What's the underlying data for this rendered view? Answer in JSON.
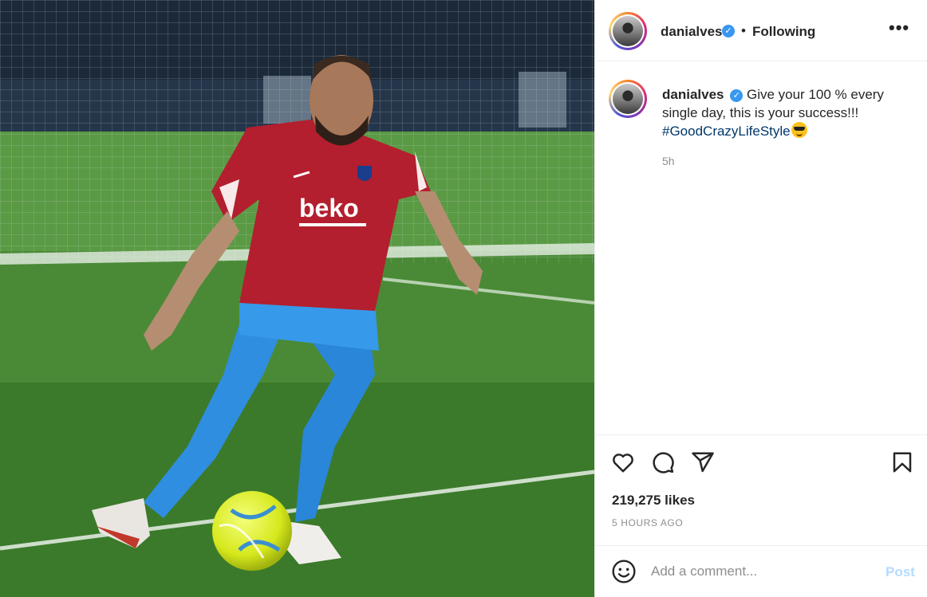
{
  "post": {
    "image_alt": "Footballer in red training shirt and blue trousers kicking a yellow ball on a pitch",
    "shirt_sponsor": "beko"
  },
  "header": {
    "username": "danialves",
    "verified_icon": "verified-badge-icon",
    "separator": "•",
    "follow_status": "Following",
    "more_label": "•••"
  },
  "caption": {
    "username": "danialves",
    "text": "Give your 100 % every single day, this is your success!!!",
    "hashtag": "#GoodCrazyLifeStyle",
    "emoji": "smiling-face-with-sunglasses-icon",
    "time": "5h"
  },
  "actions": {
    "icons": [
      "heart-icon",
      "comment-icon",
      "share-icon",
      "bookmark-icon"
    ],
    "likes": "219,275 likes",
    "posted": "5 HOURS AGO"
  },
  "comment": {
    "placeholder": "Add a comment...",
    "post_label": "Post"
  },
  "colors": {
    "link": "#00376b",
    "verified": "#3897f0",
    "post_disabled": "#b3dbff",
    "muted": "#8e8e8e"
  }
}
